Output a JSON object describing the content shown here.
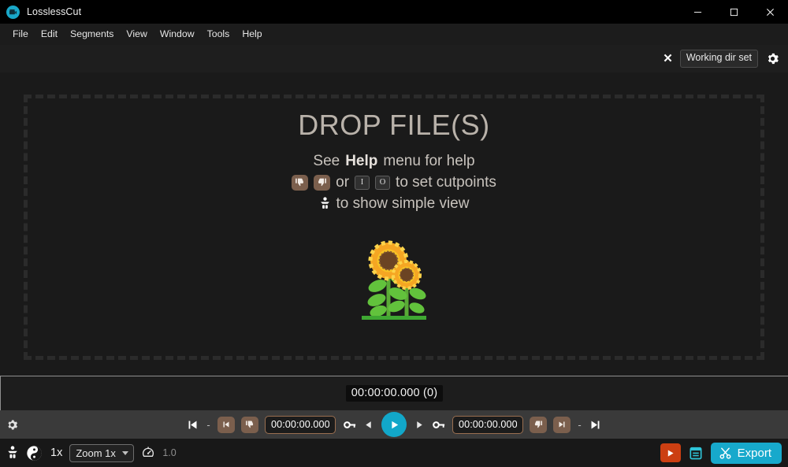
{
  "window": {
    "title": "LosslessCut",
    "app_icon": "film-camera-icon",
    "minimize_label": "–",
    "maximize_label": "□",
    "close_label": "✕"
  },
  "menubar": {
    "items": [
      {
        "label": "File"
      },
      {
        "label": "Edit"
      },
      {
        "label": "Segments"
      },
      {
        "label": "View"
      },
      {
        "label": "Window"
      },
      {
        "label": "Tools"
      },
      {
        "label": "Help"
      }
    ]
  },
  "topbar": {
    "clear_label": "✕",
    "working_dir_label": "Working dir set",
    "settings_icon": "gear-icon"
  },
  "drop_area": {
    "title": "DROP FILE(S)",
    "help_line": {
      "prefix": "See",
      "bold": "Help",
      "suffix": "menu for help"
    },
    "cutpoints_line": {
      "or_text": "or",
      "key_in": "I",
      "key_out": "O",
      "suffix": "to set cutpoints"
    },
    "simple_view_line": {
      "suffix": "to show simple view"
    },
    "graphic": "sunflowers-illustration"
  },
  "timeline": {
    "current_time": "00:00:00.000 (0)"
  },
  "controls": {
    "settings_icon": "gear-icon",
    "jump_start_icon": "skip-to-start-icon",
    "dash_left": "-",
    "prev_keyframe_icon": "previous-keyframe-icon",
    "set_cut_start_icon": "thumb-cut-start-icon",
    "start_time_value": "00:00:00.000",
    "start_time_placeholder": "00:00:00.000",
    "key_start_icon": "keyframe-key-icon",
    "step_back_icon": "step-backward-icon",
    "play_icon": "play-icon",
    "step_forward_icon": "step-forward-icon",
    "key_end_icon": "keyframe-key-icon",
    "end_time_value": "00:00:00.000",
    "end_time_placeholder": "00:00:00.000",
    "set_cut_end_icon": "thumb-cut-end-icon",
    "next_keyframe_icon": "next-keyframe-icon",
    "dash_right": "-",
    "jump_end_icon": "skip-to-end-icon"
  },
  "bottombar": {
    "simple_view_icon": "simple-view-icon",
    "yinyang_icon": "yin-yang-icon",
    "zoom_multiplier": "1x",
    "zoom_select_value": "Zoom 1x",
    "zoom_options": [
      "Zoom 1x"
    ],
    "speed_icon": "speedometer-icon",
    "playback_rate": "1.0",
    "preview_icon": "preview-play-icon",
    "segments_list_icon": "segments-list-icon",
    "export_label": "Export",
    "export_icon": "scissors-icon"
  },
  "colors": {
    "accent": "#17a9cc",
    "export_bg": "#17a9cc",
    "preview_bg": "#cc3f12",
    "cut_chip": "#7b5f4d",
    "timecode_border": "#9a6f50",
    "window_bg": "#1a1a1a"
  }
}
